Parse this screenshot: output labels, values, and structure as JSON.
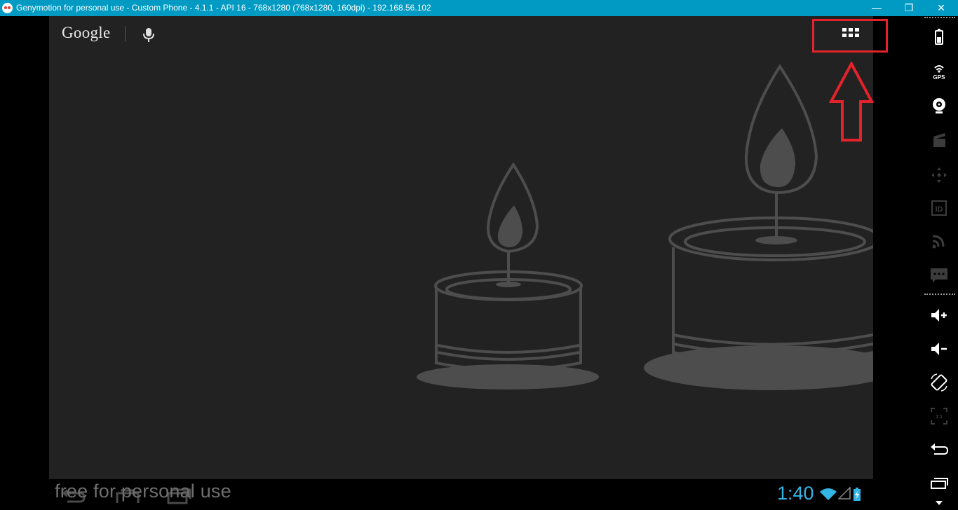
{
  "window": {
    "title": "Genymotion for personal use - Custom Phone - 4.1.1 - API 16 - 768x1280 (768x1280, 160dpi) - 192.168.56.102",
    "controls": {
      "minimize": "—",
      "maximize": "❐",
      "close": "✕"
    }
  },
  "home": {
    "search_logo": "Google",
    "apps_button_icon": "all-apps-grid-icon",
    "voice_search_icon": "microphone-icon"
  },
  "annotation": {
    "color": "#e3222a",
    "arrow_direction": "up"
  },
  "navbar": {
    "watermark": "free for personal use",
    "clock": "1:40",
    "clock_color": "#33b5e5"
  },
  "sidebar": {
    "tools": [
      {
        "name": "battery",
        "icon": "battery-icon",
        "enabled": true
      },
      {
        "name": "gps",
        "icon": "gps-icon",
        "label": "GPS",
        "enabled": true
      },
      {
        "name": "camera",
        "icon": "webcam-icon",
        "enabled": true
      },
      {
        "name": "capture",
        "icon": "clapperboard-icon",
        "enabled": false
      },
      {
        "name": "remote-control",
        "icon": "dpad-icon",
        "enabled": false
      },
      {
        "name": "device-id",
        "icon": "id-icon",
        "label": "ID",
        "enabled": false
      },
      {
        "name": "network",
        "icon": "rss-icon",
        "enabled": false
      },
      {
        "name": "sms",
        "icon": "message-icon",
        "enabled": false
      },
      {
        "name": "volume-up",
        "icon": "volume-up-icon",
        "enabled": true
      },
      {
        "name": "volume-down",
        "icon": "volume-down-icon",
        "enabled": true
      },
      {
        "name": "rotate",
        "icon": "rotate-icon",
        "enabled": true
      },
      {
        "name": "pixel-perfect",
        "icon": "scale-1-1-icon",
        "label": "1:1",
        "enabled": false
      },
      {
        "name": "back",
        "icon": "back-icon",
        "enabled": true
      },
      {
        "name": "recent-apps",
        "icon": "recent-apps-icon",
        "enabled": true
      }
    ]
  },
  "colors": {
    "titlebar": "#009ac3",
    "screen_bg": "#222222",
    "wallpaper_stroke": "#4d4d4d"
  }
}
